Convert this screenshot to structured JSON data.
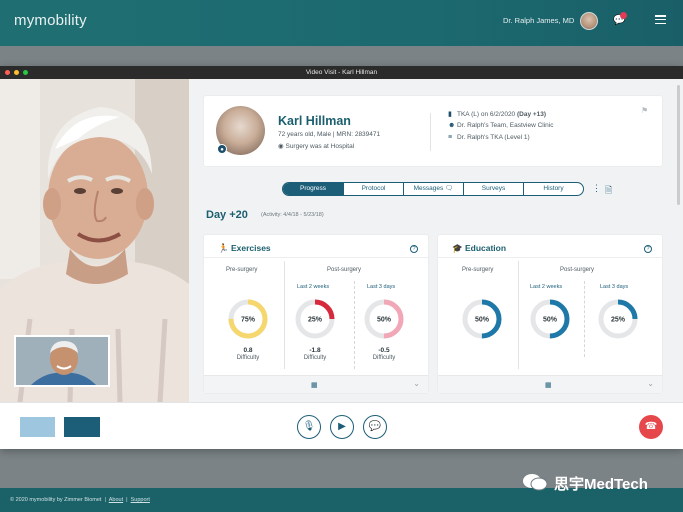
{
  "app": {
    "logo": "mymobility",
    "doctor_name": "Dr. Ralph James, MD",
    "notification_count": "0"
  },
  "window": {
    "title": "Video Visit - Karl Hillman"
  },
  "patient": {
    "name": "Karl Hillman",
    "info": "72 years old, Male | MRN: 2839471",
    "location": "Surgery was at Hospital",
    "procedure_prefix": "TKA (L) on 6/2/2020 ",
    "procedure_day": "(Day +13)",
    "team": "Dr. Ralph's Team, Eastview Clinic",
    "protocol": "Dr. Ralph's TKA (Level 1)"
  },
  "tabs": [
    "Progress",
    "Protocol",
    "Messages",
    "Surveys",
    "History"
  ],
  "day": {
    "label": "Day +20",
    "activity": "(Activity: 4/4/18 - 5/23/18)"
  },
  "exercises": {
    "title": "Exercises",
    "pre_label": "Pre-surgery",
    "post_label": "Post-surgery",
    "last2": "Last 2 weeks",
    "last3": "Last 3 days",
    "gauges": [
      {
        "value": "75%",
        "pct": 75,
        "color": "#f5d76e",
        "diff": "0.8",
        "diff_label": "Difficulty"
      },
      {
        "value": "25%",
        "pct": 25,
        "color": "#d6293c",
        "diff": "-1.8",
        "diff_label": "Difficulty"
      },
      {
        "value": "50%",
        "pct": 50,
        "color": "#f2a7b7",
        "diff": "-0.5",
        "diff_label": "Difficulty"
      }
    ]
  },
  "education": {
    "title": "Education",
    "pre_label": "Pre-surgery",
    "post_label": "Post-surgery",
    "last2": "Last 2 weeks",
    "last3": "Last 3 days",
    "gauges": [
      {
        "value": "50%",
        "pct": 50,
        "color": "#1e78a8"
      },
      {
        "value": "50%",
        "pct": 50,
        "color": "#1e78a8"
      },
      {
        "value": "25%",
        "pct": 25,
        "color": "#1e78a8"
      }
    ]
  },
  "footer": {
    "copyright": "© 2020 mymobility by Zimmer Biomet",
    "about": "About",
    "support": "Support"
  },
  "watermark": "思宇MedTech"
}
